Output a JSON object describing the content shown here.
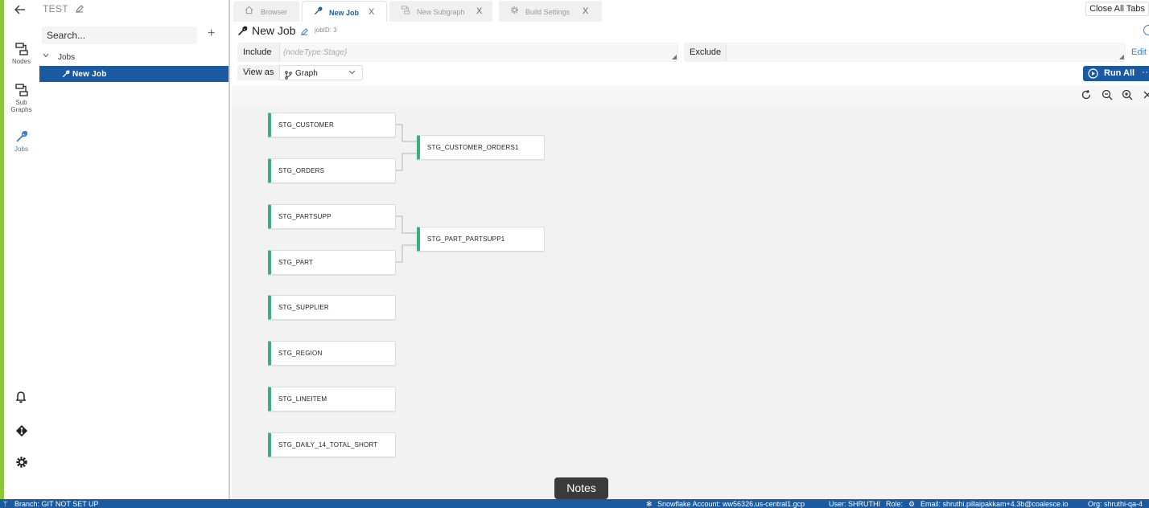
{
  "project": {
    "name": "TEST"
  },
  "rail": {
    "items": [
      {
        "label": "Nodes"
      },
      {
        "label": "Sub Graphs"
      },
      {
        "label": "Jobs"
      }
    ]
  },
  "sidebar": {
    "search_placeholder": "Search...",
    "tree": {
      "root": "Jobs",
      "child": "New Job"
    }
  },
  "tabs": [
    {
      "label": "Browser",
      "icon": "home-icon"
    },
    {
      "label": "New Job",
      "icon": "wrench-icon",
      "active": true
    },
    {
      "label": "New Subgraph",
      "icon": "subgraph-icon"
    },
    {
      "label": "Build Settings",
      "icon": "gear-icon"
    }
  ],
  "toolbar": {
    "close_all": "Close All Tabs"
  },
  "job": {
    "title": "New Job",
    "job_id": "jobID: 3"
  },
  "filters": {
    "include_label": "Include",
    "include_placeholder": "{nodeType:Stage}",
    "exclude_label": "Exclude",
    "edit_label": "Edit"
  },
  "view": {
    "label": "View as",
    "value": "Graph"
  },
  "run": {
    "label": "Run All",
    "more": "···"
  },
  "graph": {
    "nodes": [
      "STG_CUSTOMER",
      "STG_ORDERS",
      "STG_CUSTOMER_ORDERS1",
      "STG_PARTSUPP",
      "STG_PART",
      "STG_PART_PARTSUPP1",
      "STG_SUPPLIER",
      "STG_REGION",
      "STG_LINEITEM",
      "STG_DAILY_14_TOTAL_SHORT"
    ]
  },
  "status": {
    "branch": "Branch: GIT NOT SET UP",
    "account": "Snowflake Account: ww56326.us-central1.gcp",
    "user": "User: SHRUTHI",
    "role": "Role:",
    "email": "Email: shruthi.pillaipakkam+4.3b@coalesce.io",
    "org": "Org: shruthi-qa-4"
  },
  "tooltip": {
    "notes": "Notes"
  },
  "colors": {
    "accent": "#1b5aa0",
    "node_stripe": "#3ab07a",
    "rail_green": "#8cc63f"
  }
}
